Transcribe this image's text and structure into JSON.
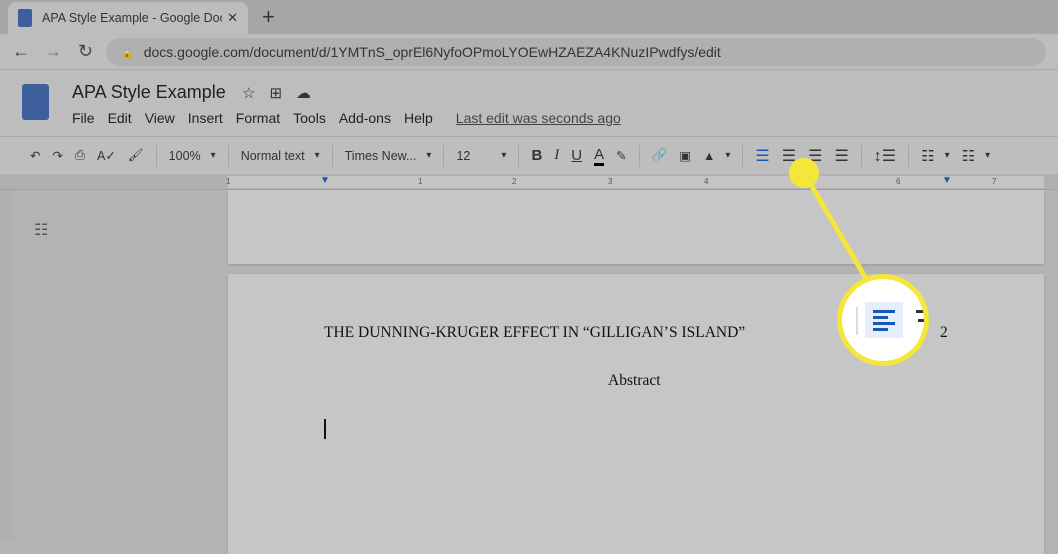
{
  "browser": {
    "tab_title": "APA Style Example - Google Docs",
    "url": "docs.google.com/document/d/1YMTnS_oprEl6NyfoOPmoLYOEwHZAEZA4KNuzIPwdfys/edit"
  },
  "doc": {
    "title": "APA Style Example",
    "menu": [
      "File",
      "Edit",
      "View",
      "Insert",
      "Format",
      "Tools",
      "Add-ons",
      "Help"
    ],
    "last_edit": "Last edit was seconds ago"
  },
  "toolbar": {
    "zoom": "100%",
    "style": "Normal text",
    "font": "Times New...",
    "size": "12",
    "bold": "B",
    "italic": "I",
    "underline": "U",
    "text_color": "A"
  },
  "ruler": [
    "1",
    "1",
    "2",
    "3",
    "4",
    "5",
    "6",
    "7"
  ],
  "page": {
    "header": "THE DUNNING-KRUGER EFFECT IN “GILLIGAN’S ISLAND”",
    "page_number": "2",
    "heading": "Abstract"
  },
  "colors": {
    "highlight": "#f5e63a",
    "accent": "#1a56b8"
  }
}
